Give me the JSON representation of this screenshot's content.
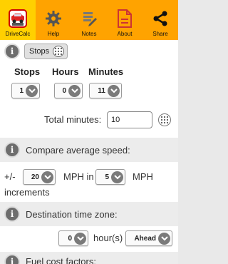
{
  "nav": {
    "items": [
      {
        "label": "DriveCalc",
        "icon": "car-icon",
        "active": true
      },
      {
        "label": "Help",
        "icon": "gear-icon"
      },
      {
        "label": "Notes",
        "icon": "notes-icon"
      },
      {
        "label": "About",
        "icon": "document-icon"
      },
      {
        "label": "Share",
        "icon": "share-icon"
      }
    ]
  },
  "stops_section": {
    "button_label": "Stops",
    "columns": {
      "stops": "Stops",
      "hours": "Hours",
      "minutes": "Minutes"
    },
    "stops_value": "1",
    "hours_value": "0",
    "minutes_value": "11",
    "total_label": "Total minutes:",
    "total_value": "10"
  },
  "speed_section": {
    "title": "Compare average speed:",
    "prefix": "+/-",
    "mph_value": "20",
    "mph_in_label": "MPH in",
    "increment_value": "5",
    "increments_label": "MPH",
    "increments_word": "increments"
  },
  "timezone_section": {
    "title": "Destination time zone:",
    "hours_value": "0",
    "hours_label": "hour(s)",
    "direction_value": "Ahead"
  },
  "fuel_section": {
    "title": "Fuel cost factors:"
  },
  "colors": {
    "nav_bg": "#ffa300",
    "nav_active": "#ffd000",
    "section_bg": "#ececec"
  }
}
